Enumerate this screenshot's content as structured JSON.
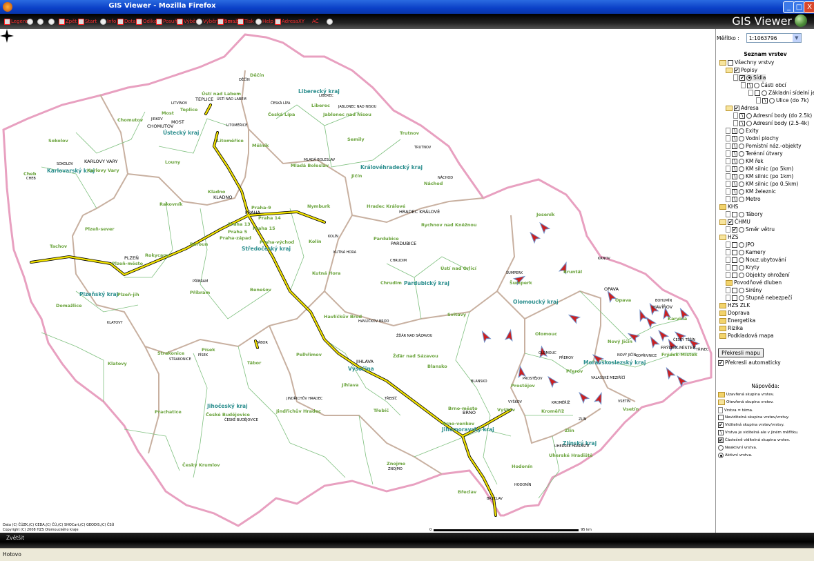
{
  "window": {
    "title": "GIS Viewer - Mozilla Firefox",
    "min": "_",
    "max": "□",
    "close": "X"
  },
  "toolbar": {
    "items": [
      "Legenda",
      "",
      "",
      "",
      "Zpět",
      "Start",
      "Info",
      "Dotaz",
      "Odíka",
      "Posuň",
      "Výběr",
      "Výběr výber",
      "Smaž",
      "Tisk",
      "Help",
      "Adresa",
      "XY",
      "AČ",
      ""
    ],
    "brand": "GIS Viewer"
  },
  "map": {
    "krajs": [
      {
        "n": "Liberecký kraj"
      },
      {
        "n": "Ústecký kraj"
      },
      {
        "n": "Karlovarský kraj"
      },
      {
        "n": "Královéhradecký kraj"
      },
      {
        "n": "Středočeský kraj"
      },
      {
        "n": "Pardubický kraj"
      },
      {
        "n": "Olomoucký kraj"
      },
      {
        "n": "Plzeňský kraj"
      },
      {
        "n": "Vysočina"
      },
      {
        "n": "Moravskoslezský kraj"
      },
      {
        "n": "Jihočeský kraj"
      },
      {
        "n": "Jihomoravský kraj"
      },
      {
        "n": "Zlínský kraj"
      }
    ],
    "districts": [
      "Děčín",
      "Ústí nad Labem",
      "Liberec",
      "Teplice",
      "Most",
      "Chomutov",
      "Česká Lípa",
      "Jablonec nad Nisou",
      "Semily",
      "Trutnov",
      "Litoměřice",
      "Mělník",
      "Mladá Boleslav",
      "Jičín",
      "Náchod",
      "Sokolov",
      "Karlovy Vary",
      "Cheb",
      "Louny",
      "Kladno",
      "Rakovník",
      "Praha-9",
      "Praha 14",
      "Praha 13",
      "Praha 15",
      "Praha 5",
      "Praha-západ",
      "Praha-východ",
      "Nymburk",
      "Hradec Králové",
      "Rychnov nad Kněžnou",
      "Jeseník",
      "Plzeň-sever",
      "Tachov",
      "Rokycany",
      "Plzeň-město",
      "Beroun",
      "Kolín",
      "Kutná Hora",
      "Pardubice",
      "Ústí nad Orlicí",
      "Chrudim",
      "Šumperk",
      "Bruntál",
      "Opava",
      "Karviná",
      "Příbram",
      "Benešov",
      "Domažlice",
      "Plzeň-jih",
      "Klatovy",
      "Havlíčkův Brod",
      "Svitavy",
      "Nový Jičín",
      "Frýdek-Místek",
      "Strakonice",
      "Písek",
      "Tábor",
      "Pelhřimov",
      "Žďár nad Sázavou",
      "Blansko",
      "Prostějov",
      "Přerov",
      "Olomouc",
      "Jihlava",
      "Vsetín",
      "Prachatice",
      "České Budějovice",
      "Jindřichův Hradec",
      "Třebíč",
      "Brno-město",
      "Brno-venkov",
      "Vyškov",
      "Kroměříž",
      "Zlín",
      "Uherské Hradiště",
      "Český Krumlov",
      "Znojmo",
      "Hodonín",
      "Břeclav"
    ],
    "cities": [
      "DĚČÍN",
      "ÚSTÍ NAD LABEM",
      "LIBEREC",
      "TEPLICE",
      "LITVÍNOV",
      "ČESKÁ LÍPA",
      "JABLONEC NAD NISOU",
      "JIRKOV",
      "CHOMUTOV",
      "MOST",
      "LITOMĚŘICE",
      "SOKOLOV",
      "KARLOVY VARY",
      "CHEB",
      "MLADÁ BOLESLAV",
      "TRUTNOV",
      "NÁCHOD",
      "KLADNO",
      "PRAHA",
      "HRADEC KRÁLOVÉ",
      "KOLÍN",
      "PARDUBICE",
      "KUTNÁ HORA",
      "CHRUDIM",
      "ŠUMPERK",
      "KRNOV",
      "OPAVA",
      "BOHUMÍN",
      "HAVÍŘOV",
      "ČESKÝ TĚŠÍN",
      "PLZEŇ",
      "PŘÍBRAM",
      "KLATOVY",
      "HAVLÍČKŮV BROD",
      "ŽĎÁR NAD SÁZAVOU",
      "FRÝDEK-MÍSTEK",
      "NOVÝ JIČÍN",
      "KOPŘIVNICE",
      "TŘINEC",
      "STRAKONICE",
      "PÍSEK",
      "TÁBOR",
      "JIHLAVA",
      "OLOMOUC",
      "PROSTĚJOV",
      "PŘEROV",
      "VALAŠSKÉ MEZIŘÍČÍ",
      "BLANSKO",
      "TŘEBÍČ",
      "VYŠKOV",
      "BRNO",
      "KROMĚŘÍŽ",
      "ZLÍN",
      "VSETÍN",
      "JINDŘICHŮV HRADEC",
      "ČESKÉ BUDĚJOVICE",
      "UHERSKÉ HRADIŠTĚ",
      "ZNOJMO",
      "HODONÍN",
      "BŘECLAV"
    ],
    "copyright": [
      "Data (C) ČÚZK,(C) CEDA,(C) ČÚ,(C) SHOCart,(C) GEODIS,(C) ČSÚ",
      "Copyright (C) 2008 HZS Olomouckého kraje"
    ],
    "scale_start": "0",
    "scale_end": "95 km"
  },
  "panel": {
    "scale_label": "Měřítko :",
    "scale_value": "1:1063796",
    "layers_title": "Seznam vrstev",
    "redraw_button": "Překresli mapu",
    "auto_redraw": "Překresli automaticky",
    "help_title": "Nápověda:",
    "help_items": [
      "Uzavřená skupina vrstev.",
      "Otevřená skupina vrstev.",
      "Vrstva = téma.",
      "Neviditelná skupina vrstev/vrstvy.",
      "Viditelná skupina vrstev/vrstvy.",
      "Vrstva je viditelná ale v jiném měřítku.",
      "Částečně viditelná skupina vrstev.",
      "Neaktivní vrstva.",
      "Aktivní vrstva."
    ]
  },
  "layers": [
    {
      "label": "Všechny vrstvy"
    },
    {
      "label": "Popisy"
    },
    {
      "label": "Sídla"
    },
    {
      "label": "Části obcí"
    },
    {
      "label": "Základní sídelní jednotky"
    },
    {
      "label": "Ulice (do 7k)"
    },
    {
      "label": "Adresa"
    },
    {
      "label": "Adresní body (do 2.5k)"
    },
    {
      "label": "Adresní body (2.5-4k)"
    },
    {
      "label": "Exity"
    },
    {
      "label": "Vodní plochy"
    },
    {
      "label": "Pomístní náz.-objekty"
    },
    {
      "label": "Terénní útvary"
    },
    {
      "label": "KM řek"
    },
    {
      "label": "KM silnic (po 5km)"
    },
    {
      "label": "KM silnic (po 1km)"
    },
    {
      "label": "KM silnic (po 0.5km)"
    },
    {
      "label": "KM železnic"
    },
    {
      "label": "Metro"
    },
    {
      "label": "KHS"
    },
    {
      "label": "Tábory"
    },
    {
      "label": "ČHMU"
    },
    {
      "label": "Směr větru"
    },
    {
      "label": "HZS"
    },
    {
      "label": "JPO"
    },
    {
      "label": "Kamery"
    },
    {
      "label": "Nouz.ubytování"
    },
    {
      "label": "Kryty"
    },
    {
      "label": "Objekty ohrožení"
    },
    {
      "label": "Povodňové dluben"
    },
    {
      "label": "Sirény"
    },
    {
      "label": "Stupně nebezpečí"
    },
    {
      "label": "HZS ZLK"
    },
    {
      "label": "Doprava"
    },
    {
      "label": "Energetika"
    },
    {
      "label": "Rizika"
    },
    {
      "label": "Podkladová mapa"
    }
  ],
  "bottom": {
    "zoom_label": "Zvětšit"
  },
  "status": {
    "text": "Hotovo"
  },
  "colors": {
    "border_kraj": "#e8a0c0",
    "border_okres": "#c8b0a0",
    "district_line": "#7fc07f",
    "highway": "#f0e000",
    "arrow": "#cc2020"
  }
}
